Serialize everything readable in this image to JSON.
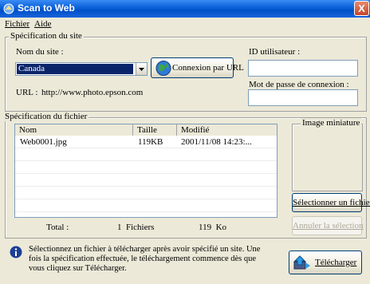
{
  "window": {
    "title": "Scan to Web",
    "close": "X"
  },
  "menu": [
    {
      "label": "Fichier"
    },
    {
      "label": "Aide"
    }
  ],
  "site_spec": {
    "legend": "Spécification du site",
    "site_name_label": "Nom du site :",
    "site_name_value": "Canada",
    "connect_button": "Connexion par URL",
    "url_label": "URL :",
    "url_value": "http://www.photo.epson.com",
    "user_id_label": "ID utilisateur :",
    "user_id_value": "",
    "password_label": "Mot de passe de connexion :",
    "password_value": ""
  },
  "file_spec": {
    "legend": "Spécification du fichier",
    "columns": [
      "Nom",
      "Taille",
      "Modifié"
    ],
    "rows": [
      {
        "name": "Web0001.jpg",
        "size": "119KB",
        "modified": "2001/11/08 14:23:..."
      }
    ],
    "total_label": "Total :",
    "total_files": "1  Fichiers",
    "total_size": "119  Ko"
  },
  "thumbnail": {
    "label": "Image miniature"
  },
  "buttons": {
    "select_file": "Sélectionner un fichier",
    "cancel_selection": "Annuler la sélection",
    "upload": "Télécharger"
  },
  "info": {
    "text": "Sélectionnez un fichier à télécharger après avoir spécifié un site. Une fois la spécification effectuée, le téléchargement commence dès que vous cliquez sur Télécharger."
  },
  "colors": {
    "titlebar": "#0a5fd8",
    "window_bg": "#ece9d8",
    "selection": "#0a246a"
  }
}
